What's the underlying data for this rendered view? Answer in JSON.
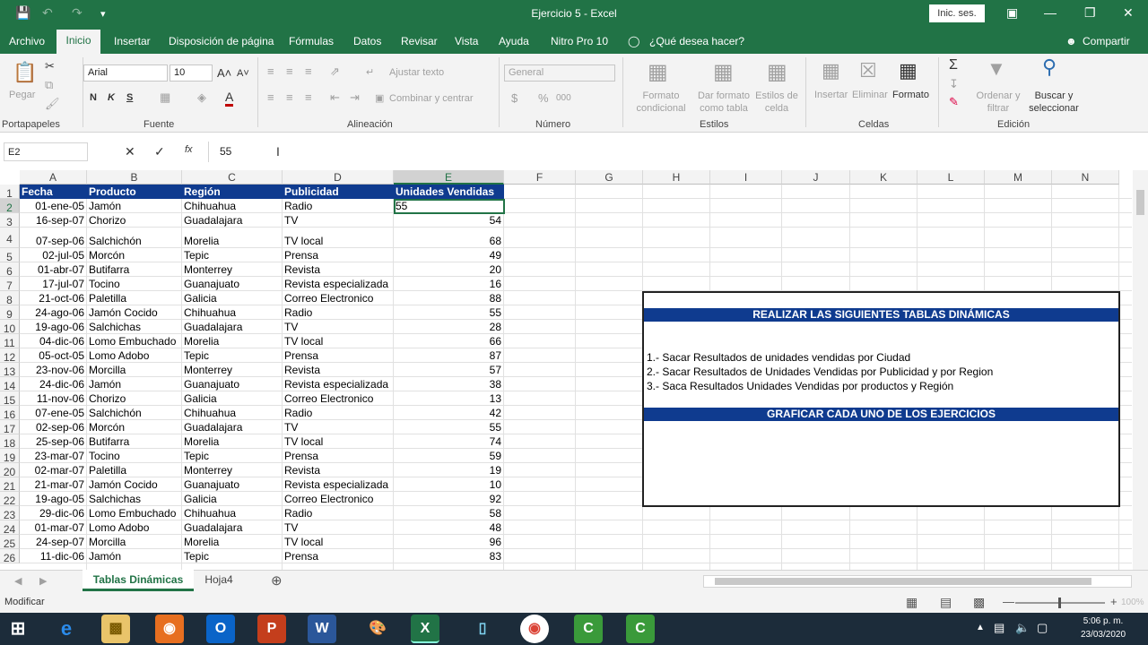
{
  "title": "Ejercicio 5  -  Excel",
  "signin": "Inic. ses.",
  "tabs": [
    "Archivo",
    "Inicio",
    "Insertar",
    "Disposición de página",
    "Fórmulas",
    "Datos",
    "Revisar",
    "Vista",
    "Ayuda",
    "Nitro Pro 10"
  ],
  "tell_me": "¿Qué desea hacer?",
  "share": "Compartir",
  "ribbon": {
    "paste": "Pegar",
    "font_name": "Arial",
    "font_size": "10",
    "bold": "N",
    "italic": "K",
    "underline": "S",
    "wrap": "Ajustar texto",
    "merge": "Combinar y centrar",
    "number_format": "General",
    "currency": "$",
    "percent": "%",
    "thousands": "000",
    "cond_format": "Formato condicional",
    "format_table": "Dar formato como tabla",
    "cell_styles": "Estilos de celda",
    "insert": "Insertar",
    "delete": "Eliminar",
    "format": "Formato",
    "sort": "Ordenar y filtrar",
    "find": "Buscar y seleccionar",
    "groups": {
      "clipboard": "Portapapeles",
      "font": "Fuente",
      "alignment": "Alineación",
      "number": "Número",
      "styles": "Estilos",
      "cells": "Celdas",
      "editing": "Edición"
    }
  },
  "formula_bar": {
    "name_box": "E2",
    "fx": "fx",
    "value": "55"
  },
  "columns": [
    "A",
    "B",
    "C",
    "D",
    "E",
    "F",
    "G",
    "H",
    "I",
    "J",
    "K",
    "L",
    "M",
    "N"
  ],
  "headers": [
    "Fecha",
    "Producto",
    "Región",
    "Publicidad",
    "Unidades Vendidas"
  ],
  "rows": [
    [
      "01-ene-05",
      "Jamón",
      "Chihuahua",
      "Radio",
      "55"
    ],
    [
      "16-sep-07",
      "Chorizo",
      "Guadalajara",
      "TV",
      "54"
    ],
    [
      "07-sep-06",
      "Salchichón",
      "Morelia",
      "TV local",
      "68"
    ],
    [
      "02-jul-05",
      "Morcón",
      "Tepic",
      "Prensa",
      "49"
    ],
    [
      "01-abr-07",
      "Butifarra",
      "Monterrey",
      "Revista",
      "20"
    ],
    [
      "17-jul-07",
      "Tocino",
      "Guanajuato",
      "Revista especializada",
      "16"
    ],
    [
      "21-oct-06",
      "Paletilla",
      "Galicia",
      "Correo Electronico",
      "88"
    ],
    [
      "24-ago-06",
      "Jamón Cocido",
      "Chihuahua",
      "Radio",
      "55"
    ],
    [
      "19-ago-06",
      "Salchichas",
      "Guadalajara",
      "TV",
      "28"
    ],
    [
      "04-dic-06",
      "Lomo Embuchado",
      "Morelia",
      "TV local",
      "66"
    ],
    [
      "05-oct-05",
      "Lomo Adobo",
      "Tepic",
      "Prensa",
      "87"
    ],
    [
      "23-nov-06",
      "Morcilla",
      "Monterrey",
      "Revista",
      "57"
    ],
    [
      "24-dic-06",
      "Jamón",
      "Guanajuato",
      "Revista especializada",
      "38"
    ],
    [
      "11-nov-06",
      "Chorizo",
      "Galicia",
      "Correo Electronico",
      "13"
    ],
    [
      "07-ene-05",
      "Salchichón",
      "Chihuahua",
      "Radio",
      "42"
    ],
    [
      "02-sep-06",
      "Morcón",
      "Guadalajara",
      "TV",
      "55"
    ],
    [
      "25-sep-06",
      "Butifarra",
      "Morelia",
      "TV local",
      "74"
    ],
    [
      "23-mar-07",
      "Tocino",
      "Tepic",
      "Prensa",
      "59"
    ],
    [
      "02-mar-07",
      "Paletilla",
      "Monterrey",
      "Revista",
      "19"
    ],
    [
      "21-mar-07",
      "Jamón Cocido",
      "Guanajuato",
      "Revista especializada",
      "10"
    ],
    [
      "19-ago-05",
      "Salchichas",
      "Galicia",
      "Correo Electronico",
      "92"
    ],
    [
      "29-dic-06",
      "Lomo Embuchado",
      "Chihuahua",
      "Radio",
      "58"
    ],
    [
      "01-mar-07",
      "Lomo Adobo",
      "Guadalajara",
      "TV",
      "48"
    ],
    [
      "24-sep-07",
      "Morcilla",
      "Morelia",
      "TV local",
      "96"
    ],
    [
      "11-dic-06",
      "Jamón",
      "Tepic",
      "Prensa",
      "83"
    ]
  ],
  "instructions": {
    "title": "REALIZAR LAS SIGUIENTES TABLAS DINÁMICAS",
    "lines": [
      "1.- Sacar Resultados   de unidades vendidas por Ciudad",
      "2.- Sacar Resultados de Unidades Vendidas por Publicidad y por Region",
      "3.- Saca Resultados Unidades Vendidas por productos y Región"
    ],
    "footer": "GRAFICAR CADA UNO DE LOS EJERCICIOS"
  },
  "sheets": [
    "Tablas Dinámicas",
    "Hoja4"
  ],
  "status": "Modificar",
  "zoom": "100%",
  "clock": {
    "time": "5:06 p. m.",
    "date": "23/03/2020"
  }
}
